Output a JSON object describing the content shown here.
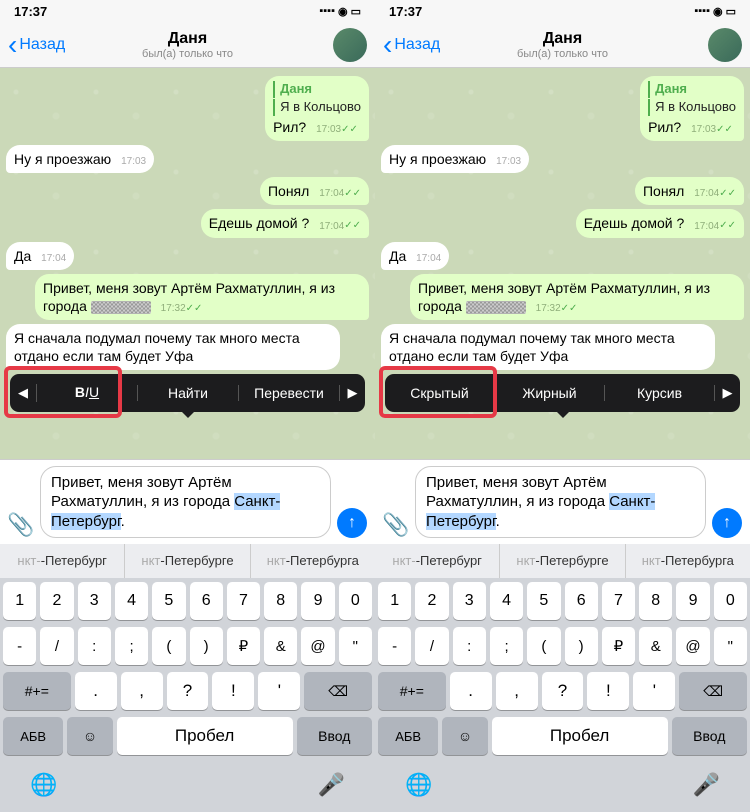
{
  "statusbar": {
    "time": "17:37"
  },
  "navbar": {
    "back": "Назад",
    "title": "Даня",
    "subtitle": "был(а) только что"
  },
  "messages": {
    "m1_reply_name": "Даня",
    "m1_reply_text": "Я в Кольцово",
    "m1_text": "Рил?",
    "m1_time": "17:03",
    "m2_text": "Ну я проезжаю",
    "m2_time": "17:03",
    "m3_text": "Понял",
    "m3_time": "17:04",
    "m4_text": "Едешь домой ?",
    "m4_time": "17:04",
    "m5_text": "Да",
    "m5_time": "17:04",
    "m6_text_a": "Привет, меня зовут Артём Рахматуллин, я из города ",
    "m6_time": "17:32",
    "m7_text": "Я сначала подумал почему так много места отдано если там будет Уфа"
  },
  "context_menu_left": {
    "item1_biu": "BIU",
    "item2": "Найти",
    "item3": "Перевести"
  },
  "context_menu_right": {
    "item1": "Скрытый",
    "item2": "Жирный",
    "item3": "Курсив"
  },
  "input": {
    "prefix": "Привет, меня зовут Артём Рахматуллин, я из города ",
    "selected": "Санкт-Петербург",
    "suffix": "."
  },
  "suggestions": {
    "s1a": "нкт-",
    "s1b": "-Петербург",
    "s2a": "нкт",
    "s2b": "-Петербурге",
    "s3a": "нкт",
    "s3b": "-Петербурга"
  },
  "keyboard": {
    "nums": [
      "1",
      "2",
      "3",
      "4",
      "5",
      "6",
      "7",
      "8",
      "9",
      "0"
    ],
    "sym": [
      "-",
      "/",
      ":",
      ";",
      "(",
      ")",
      "₽",
      "&",
      "@",
      "\""
    ],
    "punct_prefix": "#+=",
    "punct": [
      ".",
      ",",
      "?",
      "!",
      "'"
    ],
    "abc": "АБВ",
    "space": "Пробел",
    "enter": "Ввод"
  }
}
